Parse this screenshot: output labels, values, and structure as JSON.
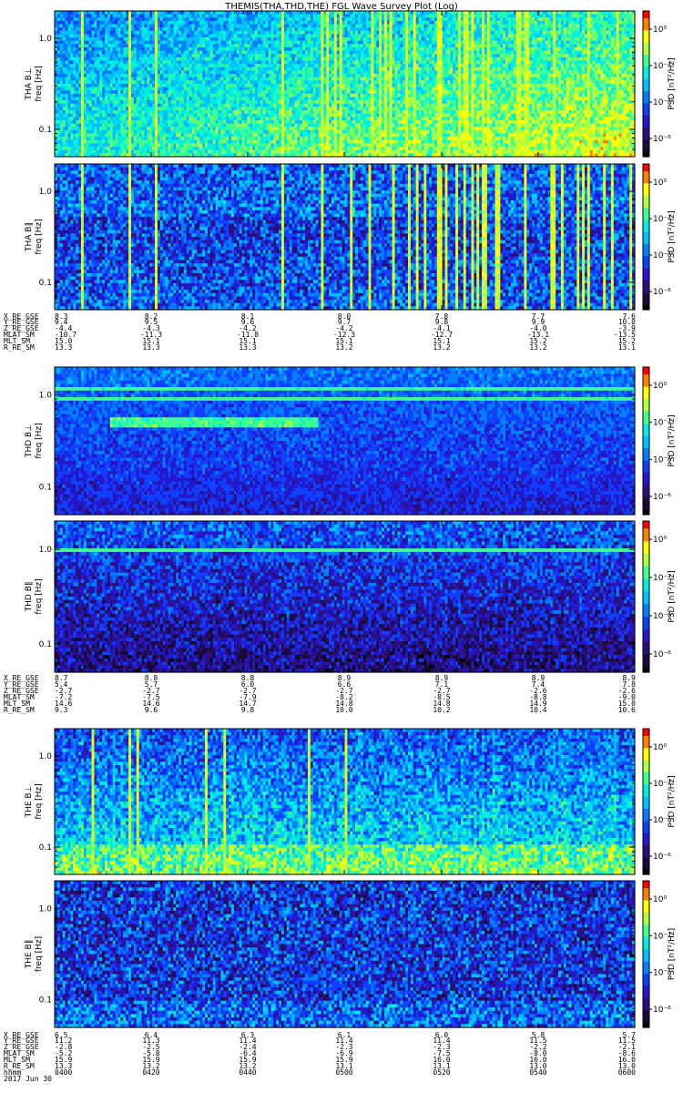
{
  "title": "THEMIS(THA,THD,THE) FGL Wave Survey Plot (Log)",
  "colors": {
    "colormap": [
      "#000000",
      "#1a0a3a",
      "#2a0f7a",
      "#2418c8",
      "#1040ff",
      "#0080ff",
      "#00c0ff",
      "#00f0e0",
      "#40ff90",
      "#b0ff40",
      "#ffff00",
      "#ff8000",
      "#ff0000"
    ]
  },
  "chart_data": [
    {
      "type": "heatmap",
      "panels": [
        {
          "ylabel_top": "THA B⊥",
          "ylabel": "freq [Hz]",
          "seed": 11,
          "mode": "perp",
          "spikes": "a"
        },
        {
          "ylabel_top": "THA B∥",
          "ylabel": "freq [Hz]",
          "seed": 23,
          "mode": "par",
          "spikes": "a"
        }
      ],
      "yticks": [
        "1.0",
        "0.1"
      ],
      "colorbar": {
        "label": "PSD [nT²/Hz]",
        "ticks": [
          "10⁰",
          "10⁻²",
          "10⁻⁴",
          "10⁻⁶"
        ]
      },
      "ephemeris": {
        "labels": [
          "X_RE_GSE",
          "Y_RE_GSE",
          "Z_RE_GSE",
          "MLAT_SM",
          "MLT_SM",
          "R_RE_SM"
        ],
        "columns": [
          [
            "8.3",
            "9.4",
            "-4.4",
            "-10.7",
            "15.0",
            "13.3"
          ],
          [
            "8.2",
            "9.5",
            "-4.3",
            "-11.3",
            "15.1",
            "13.3"
          ],
          [
            "8.1",
            "9.6",
            "-4.2",
            "-11.8",
            "15.1",
            "13.3"
          ],
          [
            "8.0",
            "9.7",
            "-4.2",
            "-12.3",
            "15.1",
            "13.2"
          ],
          [
            "7.8",
            "9.8",
            "-4.1",
            "-12.7",
            "15.1",
            "13.2"
          ],
          [
            "7.7",
            "9.9",
            "-4.0",
            "-13.1",
            "15.2",
            "13.2"
          ],
          [
            "7.6",
            "10.0",
            "-3.9",
            "-13.5",
            "15.2",
            "13.1"
          ]
        ]
      }
    },
    {
      "type": "heatmap",
      "panels": [
        {
          "ylabel_top": "THD B⊥",
          "ylabel": "freq [Hz]",
          "seed": 37,
          "mode": "dperp",
          "spikes": "none"
        },
        {
          "ylabel_top": "THD B∥",
          "ylabel": "freq [Hz]",
          "seed": 41,
          "mode": "dpar",
          "spikes": "none"
        }
      ],
      "yticks": [
        "1.0",
        "0.1"
      ],
      "colorbar": {
        "label": "PSD [nT²/Hz]",
        "ticks": [
          "10⁰",
          "10⁻²",
          "10⁻⁴",
          "10⁻⁶"
        ]
      },
      "ephemeris": {
        "labels": [
          "X_RE_GSE",
          "Y_RE_GSE",
          "Z_RE_GSE",
          "MLAT_SM",
          "MLT_SM",
          "R_RE_SM"
        ],
        "columns": [
          [
            "8.7",
            "5.4",
            "-2.7",
            "-7.2",
            "14.6",
            "9.3"
          ],
          [
            "8.8",
            "5.7",
            "-2.7",
            "-7.5",
            "14.6",
            "9.6"
          ],
          [
            "8.8",
            "6.0",
            "-2.7",
            "-7.9",
            "14.7",
            "9.8"
          ],
          [
            "8.9",
            "6.6",
            "-2.7",
            "-8.2",
            "14.8",
            "10.0"
          ],
          [
            "8.9",
            "7.1",
            "-2.7",
            "-8.5",
            "14.8",
            "10.2"
          ],
          [
            "8.9",
            "7.4",
            "-2.6",
            "-8.8",
            "14.9",
            "10.4"
          ],
          [
            "8.9",
            "7.8",
            "-2.6",
            "-9.0",
            "15.0",
            "10.6"
          ]
        ]
      }
    },
    {
      "type": "heatmap",
      "panels": [
        {
          "ylabel_top": "THE B⊥",
          "ylabel": "freq [Hz]",
          "seed": 53,
          "mode": "eperp",
          "spikes": "e"
        },
        {
          "ylabel_top": "THE B∥",
          "ylabel": "freq [Hz]",
          "seed": 67,
          "mode": "epar",
          "spikes": "none"
        }
      ],
      "yticks": [
        "1.0",
        "0.1"
      ],
      "colorbar": {
        "label": "PSD [nT²/Hz]",
        "ticks": [
          "10⁰",
          "10⁻²",
          "10⁻⁴",
          "10⁻⁶"
        ]
      },
      "ephemeris": {
        "labels": [
          "X_RE_GSE",
          "Y_RE_GSE",
          "Z_RE_GSE",
          "MLAT_SM",
          "MLT_SM",
          "R_RE_SM",
          "hhmm"
        ],
        "columns": [
          [
            "6.5",
            "11.2",
            "-2.8",
            "-5.2",
            "15.9",
            "13.3",
            "0400"
          ],
          [
            "6.4",
            "11.3",
            "-2.5",
            "-5.8",
            "15.9",
            "13.2",
            "0420"
          ],
          [
            "6.3",
            "11.4",
            "-2.4",
            "-6.4",
            "15.9",
            "13.2",
            "0440"
          ],
          [
            "6.1",
            "11.4",
            "-2.3",
            "-6.9",
            "15.9",
            "13.1",
            "0500"
          ],
          [
            "6.0",
            "11.4",
            "-2.3",
            "-7.5",
            "16.0",
            "13.1",
            "0520"
          ],
          [
            "5.8",
            "11.5",
            "-2.2",
            "-8.0",
            "16.0",
            "13.0",
            "0540"
          ],
          [
            "5.7",
            "11.5",
            "-2.1",
            "-8.6",
            "16.0",
            "13.0",
            "0600"
          ]
        ],
        "date": "2017 Jun 30"
      }
    }
  ]
}
